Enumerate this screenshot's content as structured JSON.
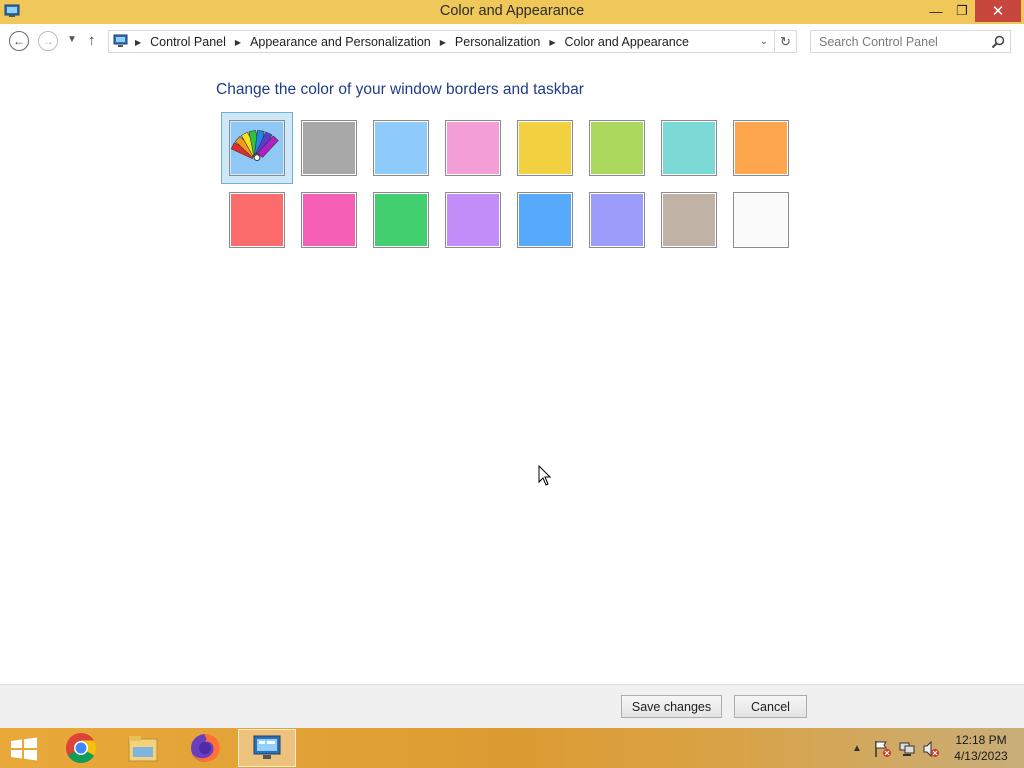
{
  "window": {
    "title": "Color and Appearance",
    "controls": {
      "minimize": "—",
      "restore": "❐",
      "close": "✕"
    }
  },
  "nav": {
    "back_icon": "back-arrow-icon",
    "forward_icon": "forward-arrow-icon",
    "up_icon": "up-arrow-icon",
    "breadcrumbs": [
      "Control Panel",
      "Appearance and Personalization",
      "Personalization",
      "Color and Appearance"
    ],
    "search_placeholder": "Search Control Panel"
  },
  "main": {
    "heading": "Change the color of your window borders and taskbar",
    "swatches": [
      {
        "name": "automatic",
        "color": "#8fc8f5",
        "selected": true
      },
      {
        "name": "gray",
        "color": "#a8a8a8"
      },
      {
        "name": "sky-blue",
        "color": "#8ecbfb"
      },
      {
        "name": "pink",
        "color": "#f39ed6"
      },
      {
        "name": "yellow",
        "color": "#f1d13f"
      },
      {
        "name": "lime",
        "color": "#acd85e"
      },
      {
        "name": "teal",
        "color": "#7bd9d6"
      },
      {
        "name": "orange",
        "color": "#fda64d"
      },
      {
        "name": "red",
        "color": "#fd6c6c"
      },
      {
        "name": "magenta",
        "color": "#f55fb5"
      },
      {
        "name": "green",
        "color": "#41cf6f"
      },
      {
        "name": "violet",
        "color": "#c38df9"
      },
      {
        "name": "blue",
        "color": "#56a9fb"
      },
      {
        "name": "periwinkle",
        "color": "#9c9cfa"
      },
      {
        "name": "taupe",
        "color": "#c0b3a6"
      },
      {
        "name": "white",
        "color": "#fafafa"
      }
    ]
  },
  "buttons": {
    "save": "Save changes",
    "cancel": "Cancel"
  },
  "taskbar": {
    "apps": [
      "chrome-icon",
      "file-explorer-icon",
      "firefox-icon",
      "control-panel-icon"
    ],
    "active": "control-panel-icon",
    "time": "12:18 PM",
    "date": "4/13/2023",
    "tray": [
      "show-hidden-icon",
      "action-center-flag-icon",
      "network-icon",
      "volume-muted-icon"
    ]
  },
  "colors": {
    "titlebar": "#f0c85a",
    "heading": "#1f3c88",
    "close_button": "#c7463d"
  }
}
